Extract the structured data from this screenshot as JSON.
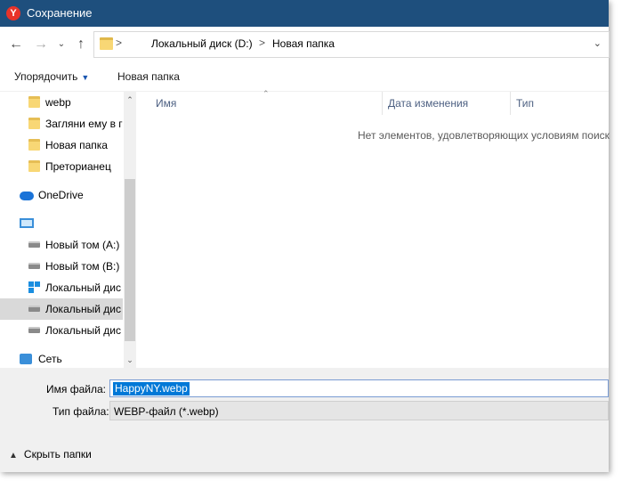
{
  "window": {
    "title": "Сохранение",
    "logo_letter": "Y"
  },
  "address": {
    "back_icon": "arrow-left-icon",
    "forward_icon": "arrow-right-icon",
    "recent_icon": "chevron-down-icon",
    "up_icon": "arrow-up-icon",
    "root_sep": ">",
    "crumbs": [
      "Локальный диск (D:)",
      "Новая папка"
    ],
    "sep": ">",
    "dropdown": "⌄"
  },
  "toolbar": {
    "organize_label": "Упорядочить",
    "organize_caret": "▼",
    "new_folder_label": "Новая папка"
  },
  "nav": {
    "items": [
      {
        "label": "webp",
        "icon": "folder-icon"
      },
      {
        "label": "Загляни ему в г",
        "icon": "folder-icon"
      },
      {
        "label": "Новая папка",
        "icon": "folder-icon"
      },
      {
        "label": "Преторианец",
        "icon": "folder-icon"
      },
      {
        "label": "OneDrive",
        "icon": "onedrive-icon"
      },
      {
        "label": "",
        "icon": "this-pc-icon"
      },
      {
        "label": "Новый том (A:)",
        "icon": "drive-icon"
      },
      {
        "label": "Новый том (B:)",
        "icon": "drive-icon"
      },
      {
        "label": "Локальный дис",
        "icon": "windows-drive-icon"
      },
      {
        "label": "Локальный дис",
        "icon": "drive-icon",
        "selected": true
      },
      {
        "label": "Локальный дис",
        "icon": "drive-icon"
      },
      {
        "label": "Сеть",
        "icon": "network-icon"
      }
    ]
  },
  "columns": {
    "name": "Имя",
    "date": "Дата изменения",
    "type": "Тип"
  },
  "content": {
    "empty_message": "Нет элементов, удовлетворяющих условиям поиск"
  },
  "form": {
    "filename_label": "Имя файла:",
    "filename_value": "HappyNY.webp",
    "filetype_label": "Тип файла:",
    "filetype_value": "WEBP-файл (*.webp)"
  },
  "footer": {
    "hide_folders_label": "Скрыть папки",
    "chevron": "▲"
  }
}
